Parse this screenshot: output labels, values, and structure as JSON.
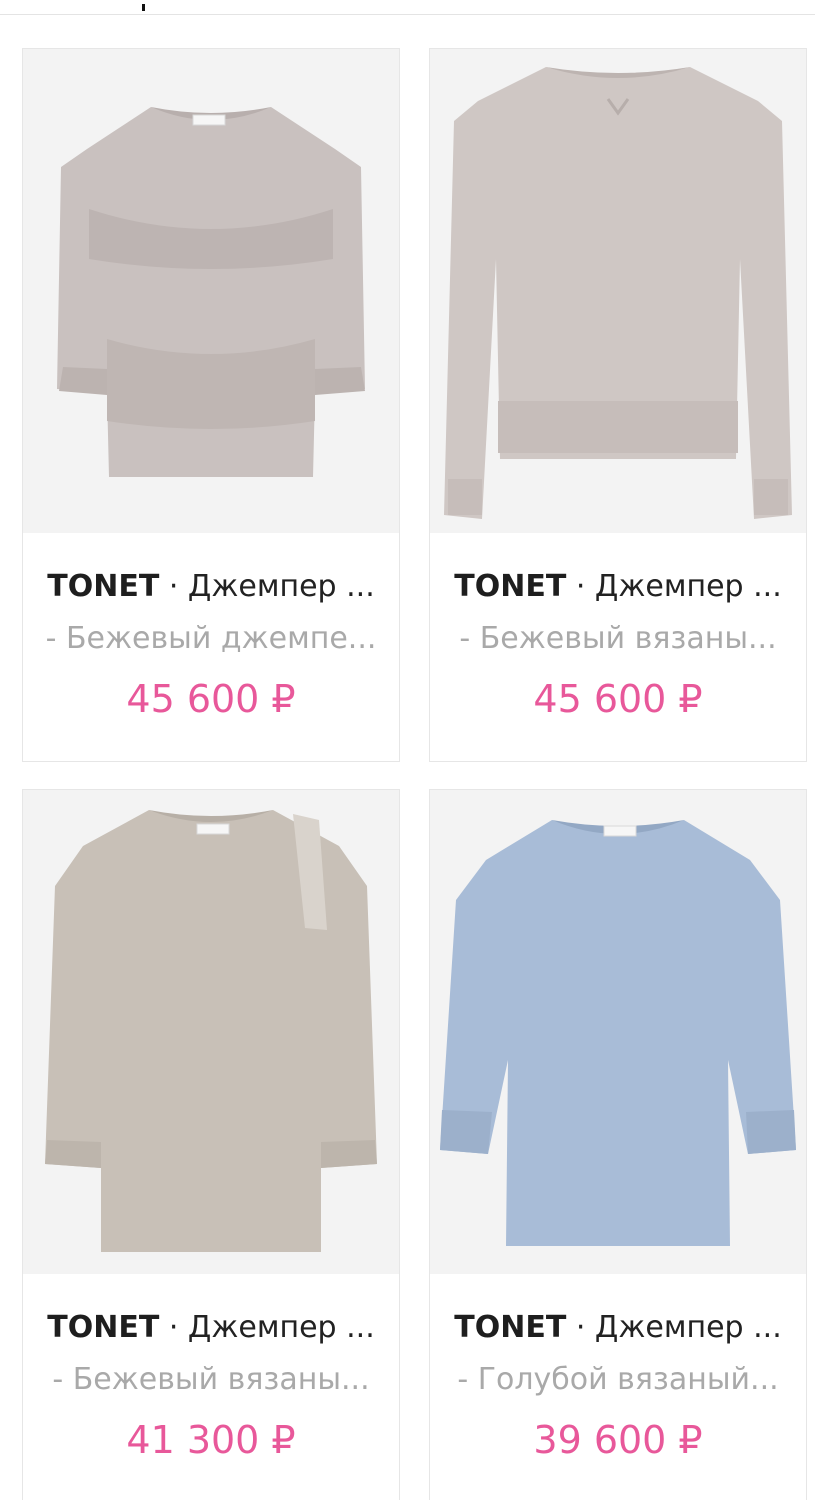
{
  "header": {
    "separator": "·"
  },
  "products": [
    {
      "brand": "TONET",
      "name": "Джемпер ...",
      "description": "- Бежевый джемпе...",
      "price": "45 600 ₽",
      "image_icon": "sweater-lace-beige-image",
      "color": "#cbc3c1"
    },
    {
      "brand": "TONET",
      "name": "Джемпер ...",
      "description": "- Бежевый вязаны...",
      "price": "45 600 ₽",
      "image_icon": "sweater-knit-beige-image",
      "color": "#d0c8c5"
    },
    {
      "brand": "TONET",
      "name": "Джемпер ...",
      "description": "- Бежевый вязаны...",
      "price": "41 300 ₽",
      "image_icon": "sweater-fringe-beige-image",
      "color": "#c9c2b9"
    },
    {
      "brand": "TONET",
      "name": "Джемпер ...",
      "description": "- Голубой вязаный...",
      "price": "39 600 ₽",
      "image_icon": "sweater-knit-blue-image",
      "color": "#a9bdd8"
    }
  ],
  "colors": {
    "price": "#e8589a",
    "description": "#a9a9a9",
    "border": "#e6e6e6"
  }
}
